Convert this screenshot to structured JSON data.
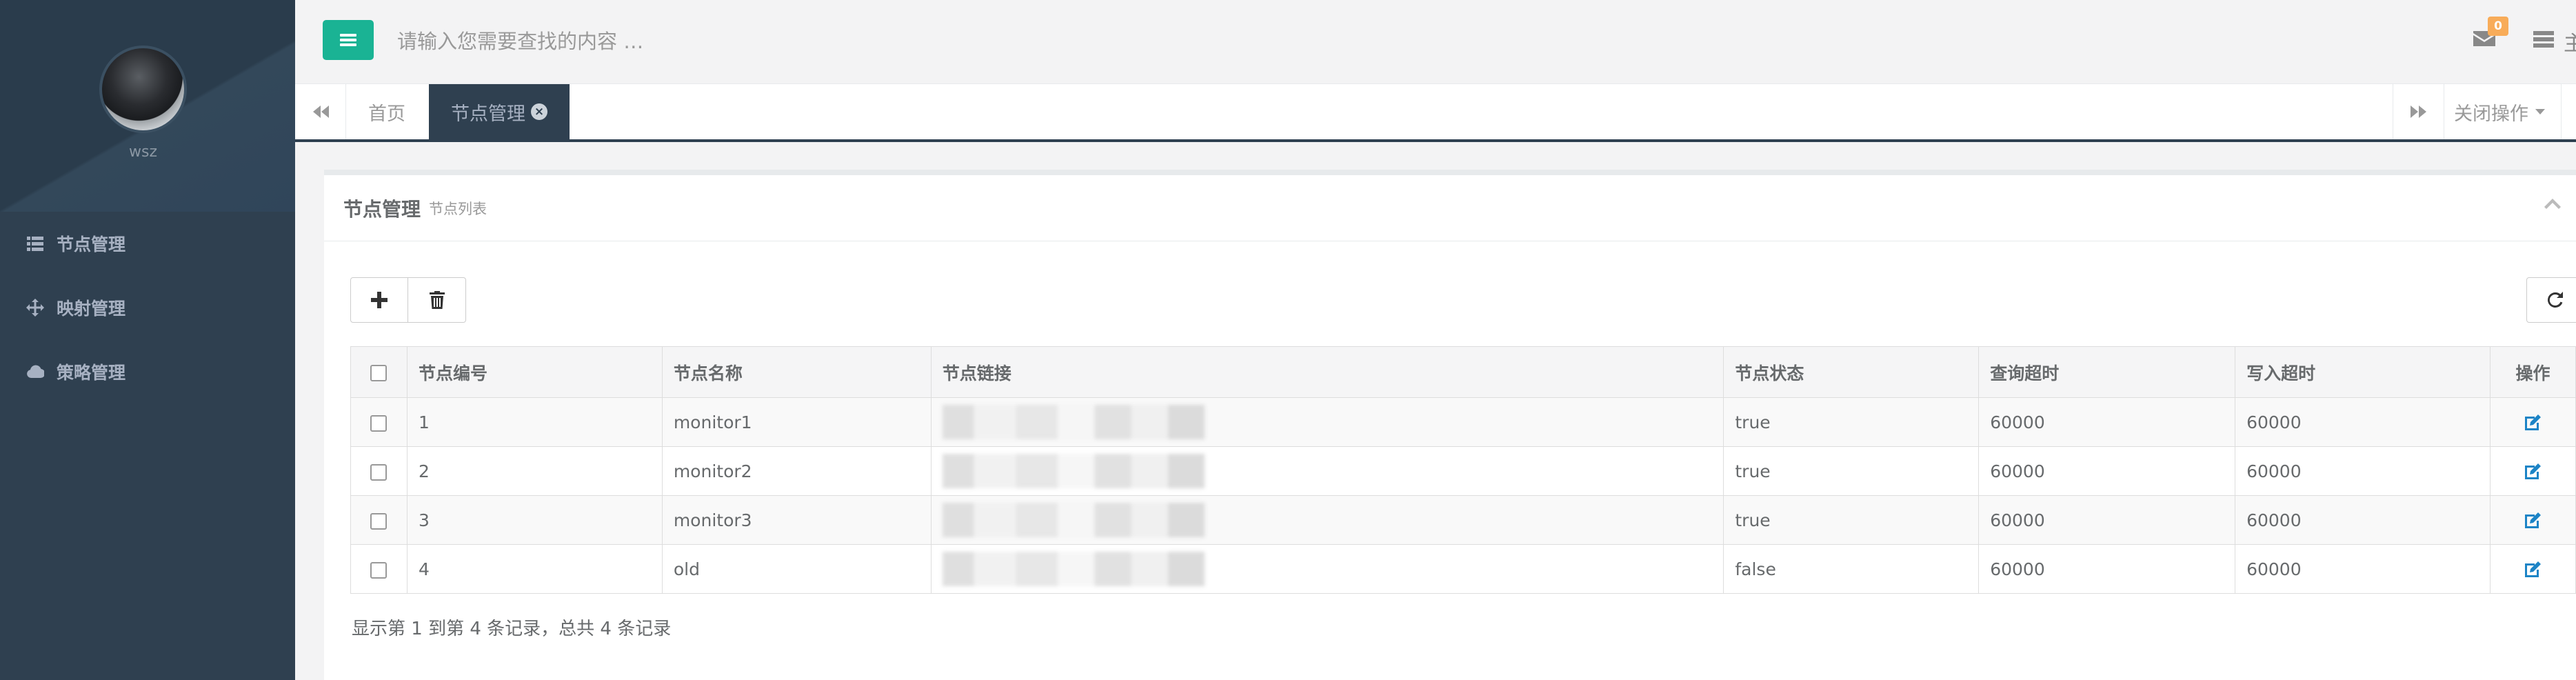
{
  "sidebar": {
    "username": "wsz",
    "items": [
      {
        "label": "节点管理",
        "icon": "list-icon"
      },
      {
        "label": "映射管理",
        "icon": "arrows-move-icon"
      },
      {
        "label": "策略管理",
        "icon": "cloud-icon"
      }
    ]
  },
  "topbar": {
    "search_placeholder": "请输入您需要查找的内容 …",
    "mail_count": "0",
    "cut_text": "主"
  },
  "tabs": {
    "home": "首页",
    "active": "节点管理",
    "close_ops": "关闭操作"
  },
  "panel": {
    "title": "节点管理",
    "subtitle": "节点列表"
  },
  "table": {
    "headers": [
      "节点编号",
      "节点名称",
      "节点链接",
      "节点状态",
      "查询超时",
      "写入超时",
      "操作"
    ],
    "rows": [
      {
        "id": "1",
        "name": "monitor1",
        "status": "true",
        "query_timeout": "60000",
        "write_timeout": "60000"
      },
      {
        "id": "2",
        "name": "monitor2",
        "status": "true",
        "query_timeout": "60000",
        "write_timeout": "60000"
      },
      {
        "id": "3",
        "name": "monitor3",
        "status": "true",
        "query_timeout": "60000",
        "write_timeout": "60000"
      },
      {
        "id": "4",
        "name": "old",
        "status": "false",
        "query_timeout": "60000",
        "write_timeout": "60000"
      }
    ]
  },
  "pagination": {
    "info": "显示第 1 到第 4 条记录，总共 4 条记录"
  },
  "colors": {
    "sidebar_bg": "#2f4050",
    "primary": "#1ab394",
    "badge": "#f8ac59",
    "link": "#1c84c6"
  }
}
